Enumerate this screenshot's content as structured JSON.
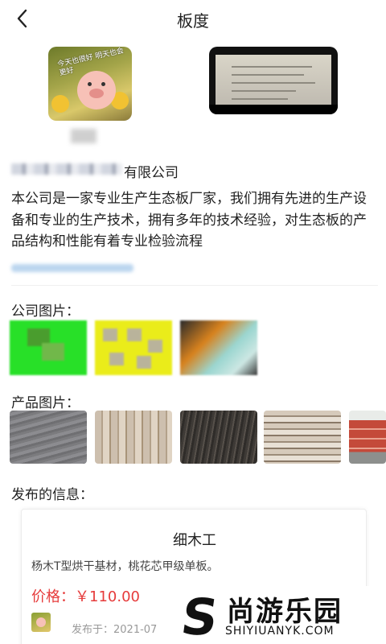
{
  "header": {
    "title": "板度"
  },
  "profile": {
    "avatar_text": "今天也很好 明天也会更好",
    "company_suffix": "有限公司",
    "description": "本公司是一家专业生产生态板厂家，我们拥有先进的生产设备和专业的生产技术，拥有多年的技术经验，对生态板的产品结构和性能有着专业检验流程"
  },
  "sections": {
    "company_images_label": "公司图片：",
    "product_images_label": "产品图片：",
    "published_label": "发布的信息："
  },
  "post": {
    "title": "细木工",
    "description": "杨木T型烘干基材，桃花芯甲级单板。",
    "price_label": "价格：",
    "price": "￥110.00",
    "date": "发布于：2021-07"
  },
  "watermark": {
    "logo": "S",
    "cn": "尚游乐园",
    "en": "SHIYIUANYK.COM"
  },
  "colors": {
    "accent": "#e63b3b",
    "muted": "#999999"
  },
  "icons": {
    "back": "chevron-left-icon"
  }
}
